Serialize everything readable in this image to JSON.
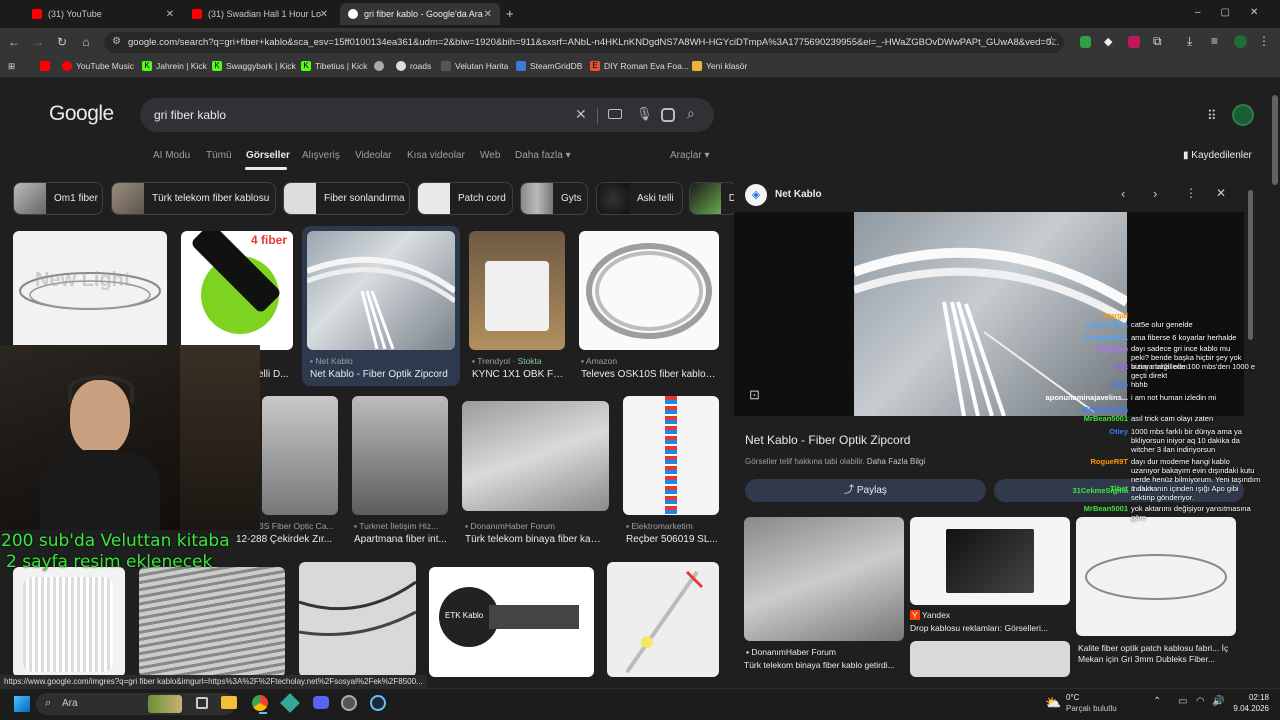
{
  "browser": {
    "tabs": [
      {
        "label": "(31) YouTube",
        "close": "✕"
      },
      {
        "label": "(31) Swadian Hall 1 Hour Lo",
        "close": "✕"
      },
      {
        "label": "gri fiber kablo - Google'da Ara",
        "close": "✕"
      }
    ],
    "new_tab": "+",
    "url": "google.com/search?q=gri+fiber+kablo&sca_esv=15ff0100134ea361&udm=2&biw=1920&bih=911&sxsrf=ANbL-n4HKLnKNDgdNS7A8WH-HGYciDTmpA%3A1775690239955&ei=_-HWaZGBOvDWwPAPt_GUwA8&ved=0...",
    "bookmarks": [
      "YouTube Music",
      "Jahrein | Kick",
      "Swaggybark | Kick",
      "Tibetius | Kick",
      "roads",
      "Velutan Harita",
      "SteamGridDB",
      "DIY Roman Eva Foa...",
      "Yeni klasör"
    ]
  },
  "google": {
    "logo": "Google",
    "query": "gri fiber kablo",
    "nav": [
      "AI Modu",
      "Tümü",
      "Görseller",
      "Alışveriş",
      "Videolar",
      "Kısa videolar",
      "Web",
      "Daha fazla"
    ],
    "tools": "Araçlar",
    "saved": "Kaydedilenler",
    "chips": [
      "Om1 fiber",
      "Türk telekom fiber kablosu",
      "Fiber sonlandırma",
      "Patch cord",
      "Gyts",
      "Aski telli",
      "D"
    ]
  },
  "results": {
    "row1": [
      {
        "source": "",
        "title": ""
      },
      {
        "source": "",
        "title": "elli D..."
      },
      {
        "source": "Net Kablo",
        "title": "Net Kablo - Fiber Optik Zipcord"
      },
      {
        "source": "Trendyol · ",
        "stock": "Stokta",
        "title": "KYNC 1X1 OBK Fİ..."
      },
      {
        "source": "Amazon",
        "title": "Televes OSK10S fiber kablo ..."
      }
    ],
    "row1_badge": "4 fiber",
    "row1_watermark": "New Light",
    "row2": [
      {
        "source": "",
        "title": ""
      },
      {
        "source": "3S Fiber Optic Ca...",
        "title": "12-288 Çekirdek Zır..."
      },
      {
        "source": "Turknet İletişim Hiz...",
        "title": "Apartmana fiber int..."
      },
      {
        "source": "DonanımHaber Forum",
        "title": "Türk telekom binaya fiber kabl..."
      },
      {
        "source": "Elektromarketim",
        "title": "Reçber 506019 SL..."
      }
    ],
    "etk_label": "ETK Kablo"
  },
  "panel": {
    "site": "Net Kablo",
    "title": "Net Kablo - Fiber Optik Zipcord",
    "copyright": "Görseller telif hakkına tabi olabilir.",
    "more_info": "Daha Fazla Bilgi",
    "share": "Paylaş",
    "related": [
      {
        "source": "DonanımHaber Forum",
        "title": "Türk telekom binaya fiber kablo getirdi..."
      },
      {
        "source": "Yandex",
        "title": "Drop kablosu reklamları: Görselleri..."
      },
      {
        "source": "",
        "title": "Kalite fiber optik patch kablosu fabri... İç Mekan için Gri 3mm Dubleks Fiber..."
      }
    ]
  },
  "stream": {
    "overlay_line1": "200 sub'da Veluttan kitaba",
    "overlay_line2": "2 sayfa resim eklenecek",
    "chat": [
      {
        "user": "Stargal",
        "msg": "",
        "color": "#ff9800"
      },
      {
        "user": "Linquei3011",
        "msg": "cat5e olur genelde",
        "color": "#4da6ff"
      },
      {
        "user": "Linquei3011",
        "msg": "ama fiberse 6 koyarlar herhalde",
        "color": "#4da6ff"
      },
      {
        "user": "Perpetva",
        "msg": "dayı sadece gri ince kablo mu peki? bende başka hiçbir şey yok kutuya bağlı olan",
        "color": "#b36bff"
      },
      {
        "user": "Volt",
        "msg": "bizim mahallede 100 mbs'den 1000 e geçti direkt",
        "color": "#9b59ff"
      },
      {
        "user": "Kibo",
        "msg": "hbhb",
        "color": "#3a7bff"
      },
      {
        "user": "aponunaminajavelins...",
        "msg": "i am not human izledin mi",
        "color": "#ffffff"
      },
      {
        "user": "Makhrolbaba",
        "msg": "",
        "color": "#3a7bff"
      },
      {
        "user": "MrBean5001",
        "msg": "asıl trick cam olayı zaten",
        "color": "#39e639"
      },
      {
        "user": "Otiey",
        "msg": "1000 mbs farklı bir dünya ama ya bkliyorsun iniyor aq 10 dakika da witcher 3 ilan indiriyorsun",
        "color": "#3a7bff"
      },
      {
        "user": "RogueR9T",
        "msg": "dayı dur modeme hangi kablo uzanıyor bakayım evin dışındaki kutu nerde henüz bilmiyorum. Yeni taşındım malum",
        "color": "#ff9800"
      },
      {
        "user": "Tibet",
        "msg": "1 dakkanın içinden ışığı Apo gibi sektirip gönderiyor.",
        "color": "#39e639"
      },
      {
        "user": "31CekmeSigma",
        "msg": "",
        "color": "#39e639"
      },
      {
        "user": "MrBean5001",
        "msg": "yok aktarımı değişiyor yansıtmasına göre",
        "color": "#39e639"
      }
    ]
  },
  "status_url": "https://www.google.com/imgres?q=gri fiber kablo&imgurl=https%3A%2F%2Ftecholay.net%2Fsosyal%2Fek%2F8500...",
  "taskbar": {
    "search": "Ara",
    "weather_temp": "0°C",
    "weather_desc": "Parçalı bulutlu",
    "time": "02:18",
    "date": "9.04.2026"
  }
}
